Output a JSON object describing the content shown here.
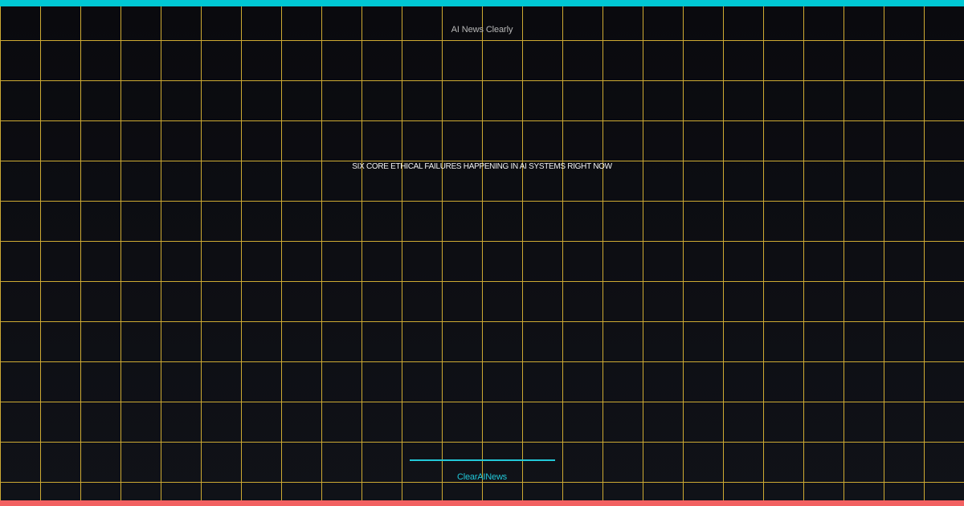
{
  "colors": {
    "top_bar": "#00c8d4",
    "bottom_bar": "#f26161",
    "grid_lines": "#d8b335",
    "accent": "#22c8d8"
  },
  "header": {
    "brand": "AI News Clearly"
  },
  "main": {
    "headline": "SIX CORE ETHICAL FAILURES HAPPENING IN AI SYSTEMS RIGHT NOW"
  },
  "footer": {
    "brand": "ClearAINews"
  }
}
